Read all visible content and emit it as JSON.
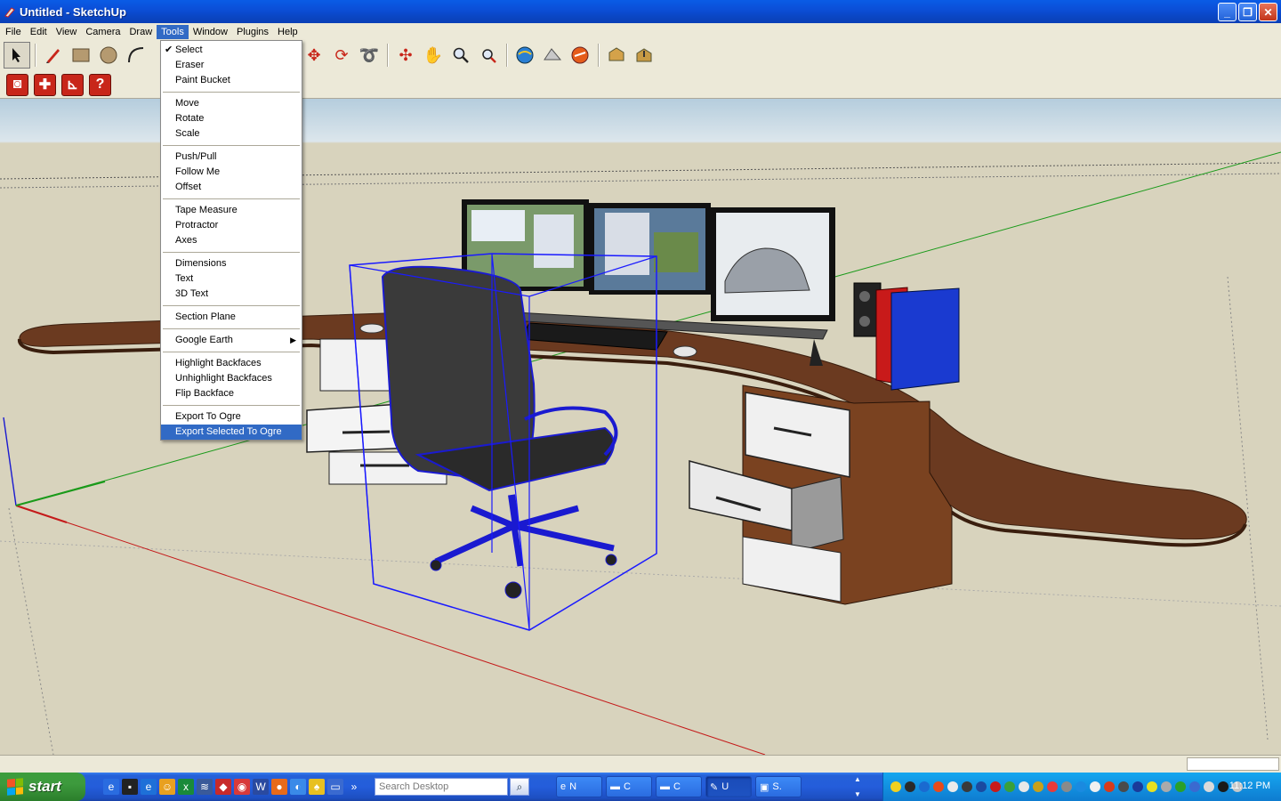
{
  "window": {
    "title": "Untitled - SketchUp",
    "minimize": "_",
    "maximize": "❐",
    "close": "✕"
  },
  "menubar": [
    {
      "label": "File"
    },
    {
      "label": "Edit"
    },
    {
      "label": "View"
    },
    {
      "label": "Camera"
    },
    {
      "label": "Draw"
    },
    {
      "label": "Tools"
    },
    {
      "label": "Window"
    },
    {
      "label": "Plugins"
    },
    {
      "label": "Help"
    }
  ],
  "tools_menu": {
    "items": [
      {
        "label": "Select",
        "checked": "✔"
      },
      {
        "label": "Eraser"
      },
      {
        "label": "Paint Bucket"
      },
      {
        "label": "Move"
      },
      {
        "label": "Rotate"
      },
      {
        "label": "Scale"
      },
      {
        "label": "Push/Pull"
      },
      {
        "label": "Follow Me"
      },
      {
        "label": "Offset"
      },
      {
        "label": "Tape Measure"
      },
      {
        "label": "Protractor"
      },
      {
        "label": "Axes"
      },
      {
        "label": "Dimensions"
      },
      {
        "label": "Text"
      },
      {
        "label": "3D Text"
      },
      {
        "label": "Section Plane"
      },
      {
        "label": "Google Earth",
        "submenu": "▶"
      },
      {
        "label": "Highlight Backfaces"
      },
      {
        "label": "Unhighlight Backfaces"
      },
      {
        "label": "Flip Backface"
      },
      {
        "label": "Export To Ogre"
      },
      {
        "label": "Export Selected To Ogre"
      }
    ]
  },
  "taskbar": {
    "start": "start",
    "search_placeholder": "Search Desktop",
    "tasks": [
      {
        "label": "N"
      },
      {
        "label": "C"
      },
      {
        "label": "C"
      },
      {
        "label": "U"
      },
      {
        "label": "S."
      }
    ],
    "clock": "11:12 PM"
  },
  "colors": {
    "title_bar": "#0a4fd8",
    "menu_highlight": "#316ac5",
    "ground": "#d8d3bd",
    "selection_box": "#1a1aff",
    "desk": "#6b3a20"
  }
}
